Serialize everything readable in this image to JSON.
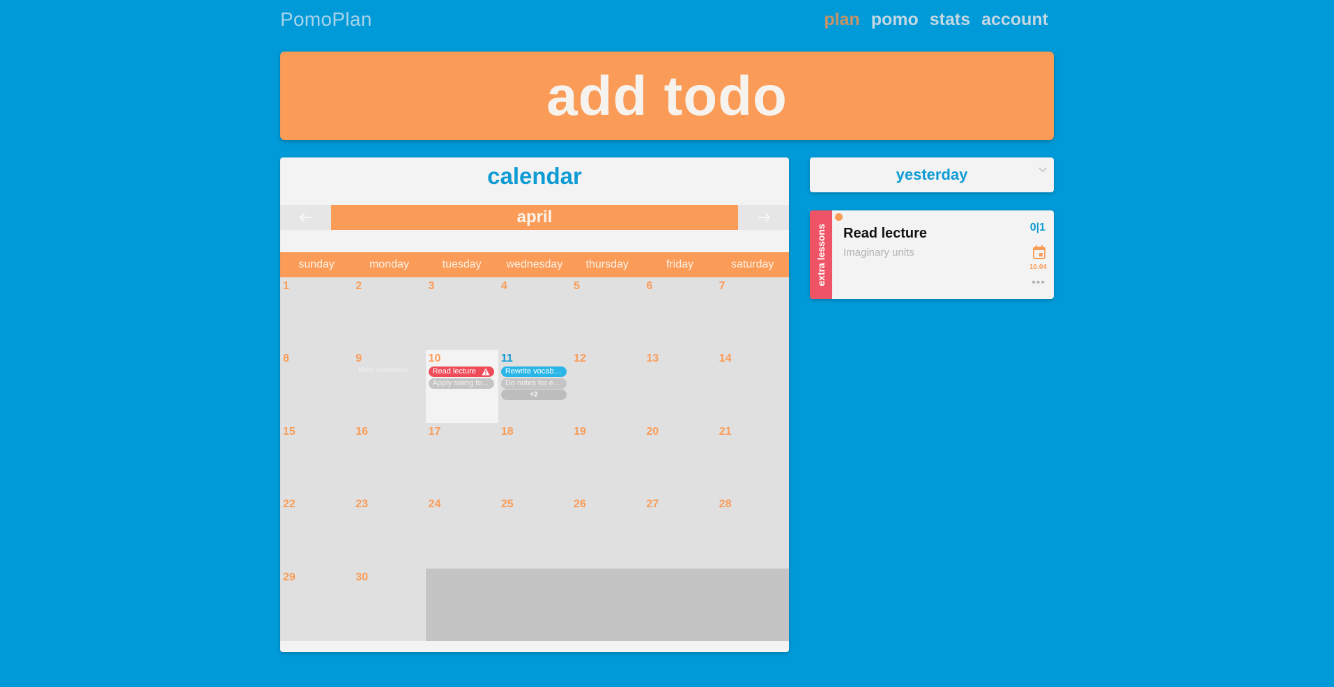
{
  "app": {
    "title": "PomoPlan"
  },
  "nav": {
    "plan": "plan",
    "pomo": "pomo",
    "stats": "stats",
    "account": "account"
  },
  "add_todo": {
    "label": "add todo"
  },
  "calendar": {
    "title": "calendar",
    "month": "april",
    "weekdays": [
      "sunday",
      "monday",
      "tuesday",
      "wednesday",
      "thursday",
      "friday",
      "saturday"
    ],
    "days": [
      "1",
      "2",
      "3",
      "4",
      "5",
      "6",
      "7",
      "8",
      "9",
      "10",
      "11",
      "12",
      "13",
      "14",
      "15",
      "16",
      "17",
      "18",
      "19",
      "20",
      "21",
      "22",
      "23",
      "24",
      "25",
      "26",
      "27",
      "28",
      "29",
      "30"
    ],
    "events": {
      "day9": [
        "Math homework"
      ],
      "day10": [
        "Read lecture",
        "Apply swing fo..."
      ],
      "day11": [
        "Rewrite vocabu...",
        "Do notes for ex...",
        "+2"
      ]
    }
  },
  "filter": {
    "selected": "yesterday"
  },
  "todo_card": {
    "tag": "extra lessons",
    "title": "Read lecture",
    "subtitle": "Imaginary units",
    "progress": "0|1",
    "date": "10.04"
  },
  "colors": {
    "background": "#009ad8",
    "accent": "#fa9c58",
    "primary_text": "#0d9bd3",
    "warning": "#ef4c5a"
  }
}
